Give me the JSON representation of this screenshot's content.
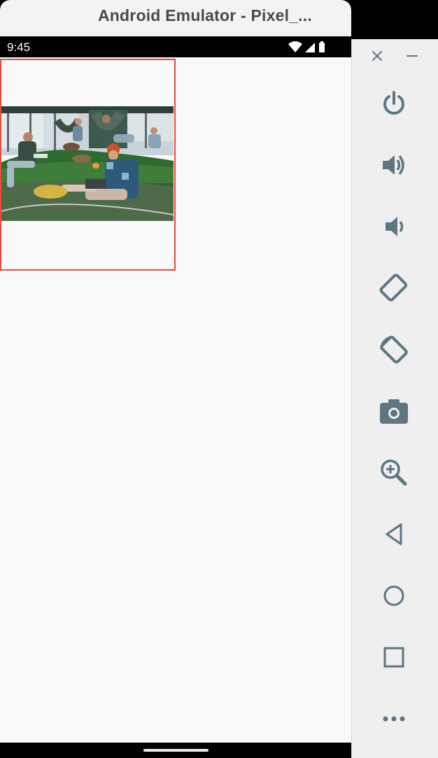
{
  "window": {
    "title": "Android Emulator - Pixel_..."
  },
  "status_bar": {
    "time": "9:45",
    "icons": [
      "wifi-icon",
      "cell-signal-icon",
      "battery-icon"
    ]
  },
  "content": {
    "image": {
      "description_icon": "photo-image",
      "selected": true,
      "selection_color": "#ea4b3c"
    }
  },
  "side_toolbar": {
    "window_controls": [
      "close-icon",
      "minimize-icon"
    ],
    "buttons": [
      {
        "icon": "power-icon"
      },
      {
        "icon": "volume-up-icon"
      },
      {
        "icon": "volume-down-icon"
      },
      {
        "icon": "rotate-left-icon"
      },
      {
        "icon": "rotate-right-icon"
      },
      {
        "icon": "camera-icon"
      },
      {
        "icon": "zoom-in-icon"
      },
      {
        "icon": "back-icon"
      },
      {
        "icon": "home-icon"
      },
      {
        "icon": "overview-icon"
      },
      {
        "icon": "more-icon"
      }
    ],
    "icon_color": "#5e7682"
  }
}
